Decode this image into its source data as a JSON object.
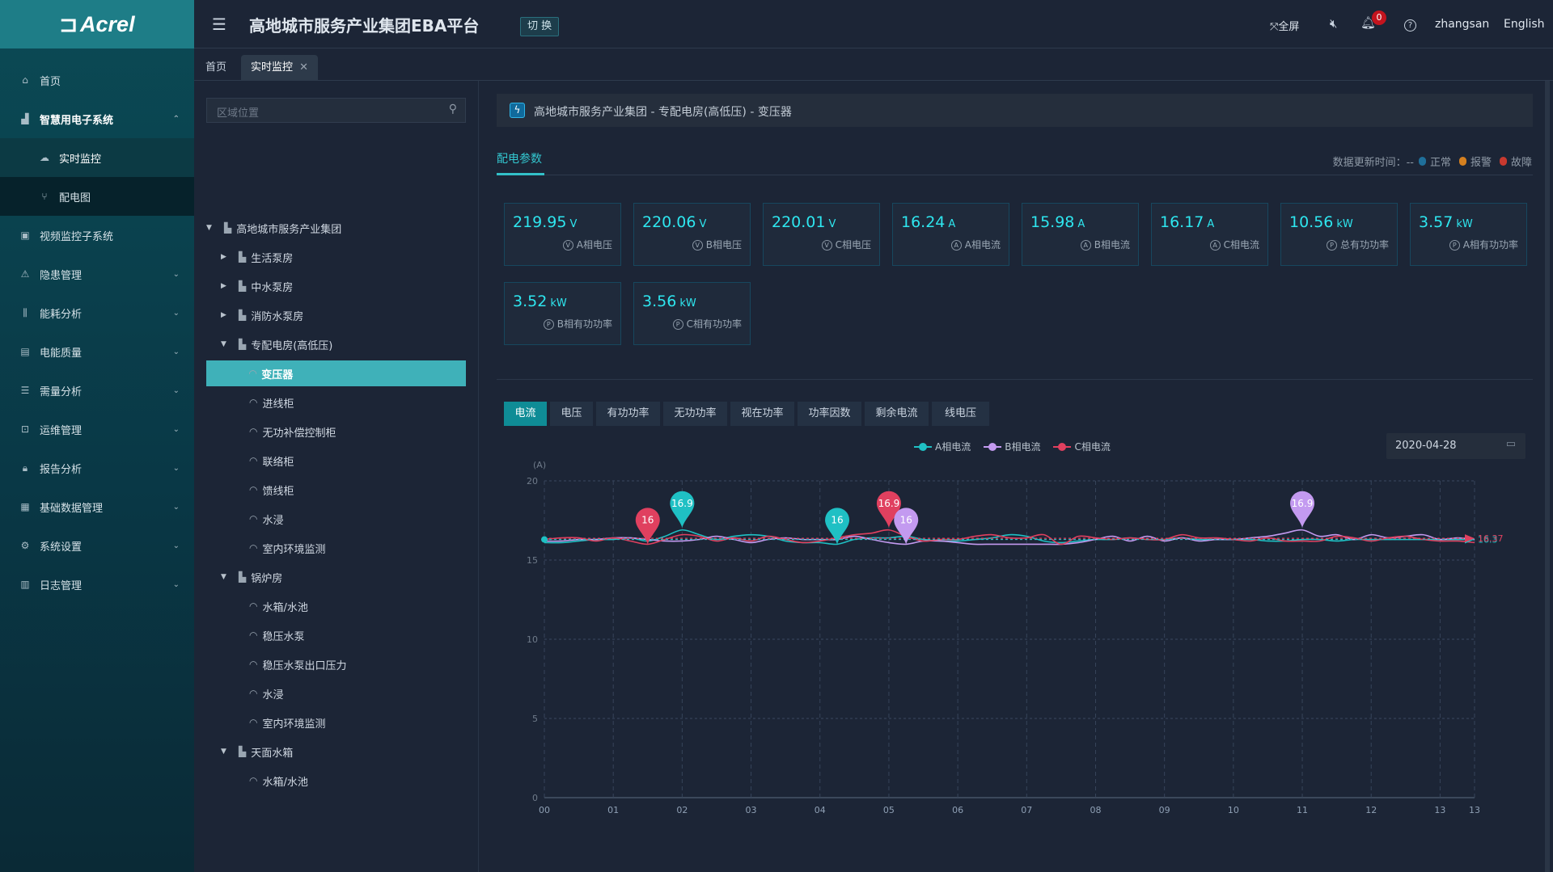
{
  "app": {
    "logo": "Acrel",
    "title": "高地城市服务产业集团EBA平台",
    "switch_label": "切 换"
  },
  "header": {
    "fullscreen": "全屏",
    "notification_count": "0",
    "user": "zhangsan",
    "language": "English"
  },
  "sidebar": {
    "items": [
      {
        "label": "首页",
        "icon": "home-icon"
      },
      {
        "label": "智慧用电子系统",
        "icon": "chart-icon",
        "expanded": true
      },
      {
        "label": "实时监控",
        "icon": "cloud-icon",
        "sub": true,
        "active": true
      },
      {
        "label": "配电图",
        "icon": "branch-icon",
        "sub": true
      },
      {
        "label": "视频监控子系统",
        "icon": "video-icon"
      },
      {
        "label": "隐患管理",
        "icon": "warning-icon"
      },
      {
        "label": "能耗分析",
        "icon": "sliders-icon"
      },
      {
        "label": "电能质量",
        "icon": "calendar-icon"
      },
      {
        "label": "需量分析",
        "icon": "list-icon"
      },
      {
        "label": "运维管理",
        "icon": "tool-icon"
      },
      {
        "label": "报告分析",
        "icon": "lock-icon"
      },
      {
        "label": "基础数据管理",
        "icon": "database-icon"
      },
      {
        "label": "系统设置",
        "icon": "gear-icon"
      },
      {
        "label": "日志管理",
        "icon": "log-icon"
      }
    ]
  },
  "tabs": [
    {
      "label": "首页"
    },
    {
      "label": "实时监控",
      "active": true
    }
  ],
  "tree": {
    "search_placeholder": "区域位置",
    "nodes": [
      {
        "label": "高地城市服务产业集团",
        "level": 0,
        "arrow": "down",
        "type": "building"
      },
      {
        "label": "生活泵房",
        "level": 1,
        "arrow": "right",
        "type": "building"
      },
      {
        "label": "中水泵房",
        "level": 1,
        "arrow": "right",
        "type": "building"
      },
      {
        "label": "消防水泵房",
        "level": 1,
        "arrow": "right",
        "type": "building"
      },
      {
        "label": "专配电房(高低压)",
        "level": 1,
        "arrow": "down",
        "type": "building"
      },
      {
        "label": "变压器",
        "level": 2,
        "type": "device",
        "selected": true
      },
      {
        "label": "进线柜",
        "level": 2,
        "type": "device"
      },
      {
        "label": "无功补偿控制柜",
        "level": 2,
        "type": "device"
      },
      {
        "label": "联络柜",
        "level": 2,
        "type": "device"
      },
      {
        "label": "馈线柜",
        "level": 2,
        "type": "device"
      },
      {
        "label": "水浸",
        "level": 2,
        "type": "device"
      },
      {
        "label": "室内环境监测",
        "level": 2,
        "type": "device"
      },
      {
        "label": "锅炉房",
        "level": 1,
        "arrow": "down",
        "type": "building"
      },
      {
        "label": "水箱/水池",
        "level": 2,
        "type": "device"
      },
      {
        "label": "稳压水泵",
        "level": 2,
        "type": "device"
      },
      {
        "label": "稳压水泵出口压力",
        "level": 2,
        "type": "device"
      },
      {
        "label": "水浸",
        "level": 2,
        "type": "device"
      },
      {
        "label": "室内环境监测",
        "level": 2,
        "type": "device"
      },
      {
        "label": "天面水箱",
        "level": 1,
        "arrow": "down",
        "type": "building"
      },
      {
        "label": "水箱/水池",
        "level": 2,
        "type": "device"
      }
    ]
  },
  "main": {
    "breadcrumb": "高地城市服务产业集团 - 专配电房(高低压) - 变压器",
    "section_tab": "配电参数",
    "update_time_label": "数据更新时间：--",
    "status_legend": [
      {
        "label": "正常",
        "color": "#1f6f9a"
      },
      {
        "label": "报警",
        "color": "#d5801f"
      },
      {
        "label": "故障",
        "color": "#c8392f"
      }
    ],
    "cards": [
      {
        "value": "219.95",
        "unit": "V",
        "label": "A相电压",
        "icon": "V"
      },
      {
        "value": "220.06",
        "unit": "V",
        "label": "B相电压",
        "icon": "V"
      },
      {
        "value": "220.01",
        "unit": "V",
        "label": "C相电压",
        "icon": "V"
      },
      {
        "value": "16.24",
        "unit": "A",
        "label": "A相电流",
        "icon": "A"
      },
      {
        "value": "15.98",
        "unit": "A",
        "label": "B相电流",
        "icon": "A"
      },
      {
        "value": "16.17",
        "unit": "A",
        "label": "C相电流",
        "icon": "A"
      },
      {
        "value": "10.56",
        "unit": "kW",
        "label": "总有功功率",
        "icon": "P"
      },
      {
        "value": "3.57",
        "unit": "kW",
        "label": "A相有功功率",
        "icon": "P"
      },
      {
        "value": "3.52",
        "unit": "kW",
        "label": "B相有功功率",
        "icon": "P"
      },
      {
        "value": "3.56",
        "unit": "kW",
        "label": "C相有功功率",
        "icon": "P"
      }
    ],
    "chart_tabs": [
      {
        "label": "电流",
        "active": true
      },
      {
        "label": "电压"
      },
      {
        "label": "有功功率"
      },
      {
        "label": "无功功率"
      },
      {
        "label": "视在功率"
      },
      {
        "label": "功率因数"
      },
      {
        "label": "剩余电流"
      },
      {
        "label": "线电压"
      }
    ],
    "date": "2020-04-28"
  },
  "chart_data": {
    "type": "line",
    "ylabel": "(A)",
    "ylim": [
      0,
      20
    ],
    "yticks": [
      0,
      5,
      10,
      15,
      20
    ],
    "xlim": [
      0,
      13.5
    ],
    "xtick_labels": [
      "00",
      "01",
      "02",
      "03",
      "04",
      "05",
      "06",
      "07",
      "08",
      "09",
      "10",
      "11",
      "12",
      "13",
      "13"
    ],
    "x_step_hours": 0.25,
    "grid": true,
    "legend_position": "top-center",
    "series": [
      {
        "name": "A相电流",
        "color": "#1fc0c4",
        "values": [
          16.1,
          16.1,
          16.2,
          16.3,
          16.3,
          16.4,
          16.2,
          16.5,
          16.9,
          16.6,
          16.3,
          16.5,
          16.6,
          16.5,
          16.2,
          16.1,
          16.1,
          16.0,
          16.3,
          16.4,
          16.4,
          16.5,
          16.3,
          16.2,
          16.2,
          16.3,
          16.4,
          16.6,
          16.5,
          16.2,
          16.1,
          16.2,
          16.3,
          16.3,
          16.4,
          16.3,
          16.3,
          16.4,
          16.3,
          16.3,
          16.3,
          16.3,
          16.2,
          16.2,
          16.3,
          16.3,
          16.2,
          16.3,
          16.3,
          16.3,
          16.3,
          16.3,
          16.3,
          16.3,
          16.3
        ]
      },
      {
        "name": "B相电流",
        "color": "#c39af0",
        "values": [
          16.2,
          16.2,
          16.3,
          16.3,
          16.4,
          16.4,
          16.3,
          16.2,
          16.2,
          16.3,
          16.5,
          16.3,
          16.1,
          16.3,
          16.4,
          16.3,
          16.3,
          16.3,
          16.5,
          16.3,
          16.1,
          16.0,
          16.2,
          16.2,
          16.1,
          16.0,
          16.0,
          16.0,
          16.0,
          16.0,
          16.0,
          16.1,
          16.3,
          16.5,
          16.2,
          16.5,
          16.2,
          16.4,
          16.2,
          16.3,
          16.3,
          16.4,
          16.5,
          16.7,
          16.9,
          16.5,
          16.6,
          16.3,
          16.6,
          16.4,
          16.5,
          16.6,
          16.3,
          16.4,
          16.3
        ]
      },
      {
        "name": "C相电流",
        "color": "#e0405f",
        "values": [
          16.3,
          16.4,
          16.4,
          16.2,
          16.4,
          16.2,
          16.0,
          16.3,
          16.6,
          16.5,
          16.2,
          16.4,
          16.2,
          16.5,
          16.3,
          16.1,
          16.2,
          16.4,
          16.6,
          16.7,
          16.9,
          16.5,
          16.2,
          16.3,
          16.3,
          16.5,
          16.6,
          16.4,
          16.4,
          16.6,
          16.0,
          16.5,
          16.4,
          16.3,
          16.4,
          16.3,
          16.3,
          16.6,
          16.4,
          16.4,
          16.3,
          16.2,
          16.4,
          16.2,
          16.2,
          16.2,
          16.5,
          16.4,
          16.2,
          16.4,
          16.5,
          16.3,
          16.2,
          16.2,
          16.1
        ]
      }
    ],
    "mark_points": [
      {
        "series": 2,
        "x": 1.5,
        "y": 16,
        "label": "16"
      },
      {
        "series": 0,
        "x": 2.0,
        "y": 16.9,
        "label": "16.9"
      },
      {
        "series": 0,
        "x": 4.25,
        "y": 16,
        "label": "16"
      },
      {
        "series": 2,
        "x": 5.0,
        "y": 16.9,
        "label": "16.9"
      },
      {
        "series": 1,
        "x": 5.25,
        "y": 16,
        "label": "16"
      },
      {
        "series": 1,
        "x": 11.0,
        "y": 16.9,
        "label": "16.9"
      }
    ],
    "average_lines": [
      {
        "series": 0,
        "value": 16.3,
        "label": "16.3"
      },
      {
        "series": 2,
        "value": 16.37,
        "label": "16.37"
      }
    ]
  }
}
